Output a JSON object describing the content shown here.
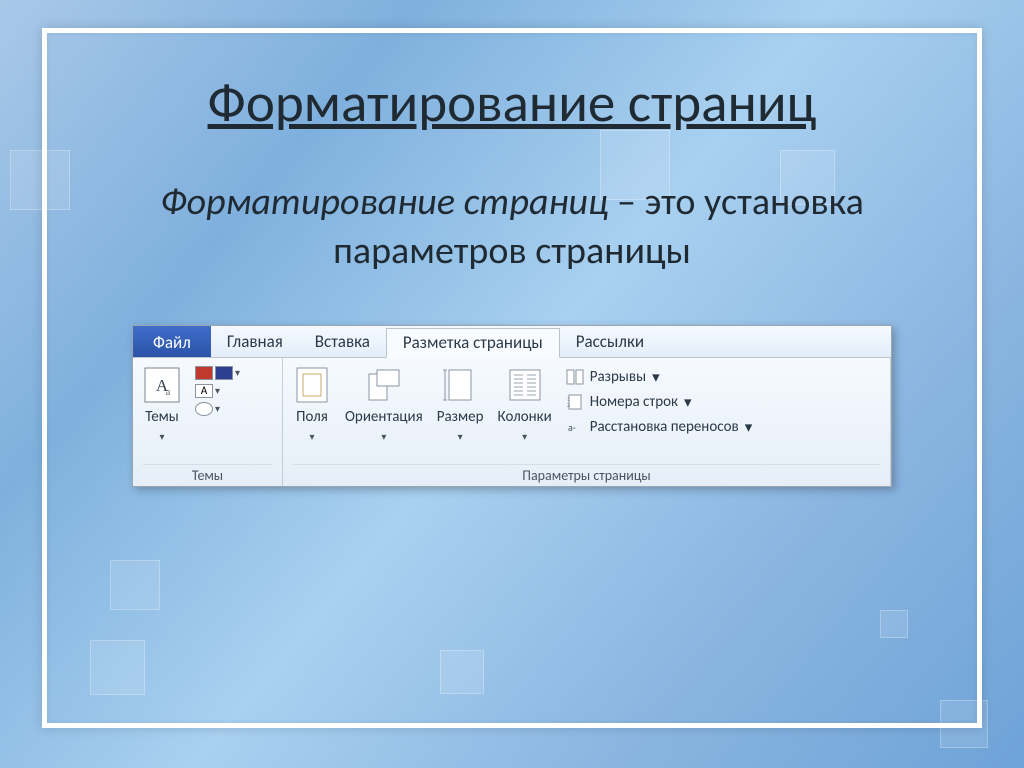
{
  "title": "Форматирование страниц",
  "subtitle_italic": "Форматирование страниц",
  "subtitle_rest": " – это установка параметров страницы",
  "tabs": {
    "file": "Файл",
    "home": "Главная",
    "insert": "Вставка",
    "page_layout": "Разметка страницы",
    "mailings": "Рассылки"
  },
  "groups": {
    "themes": {
      "label": "Темы",
      "themes_btn": "Темы"
    },
    "page_setup": {
      "label": "Параметры страницы",
      "margins": "Поля",
      "orientation": "Ориентация",
      "size": "Размер",
      "columns": "Колонки",
      "breaks": "Разрывы",
      "line_numbers": "Номера строк",
      "hyphenation": "Расстановка переносов"
    }
  }
}
